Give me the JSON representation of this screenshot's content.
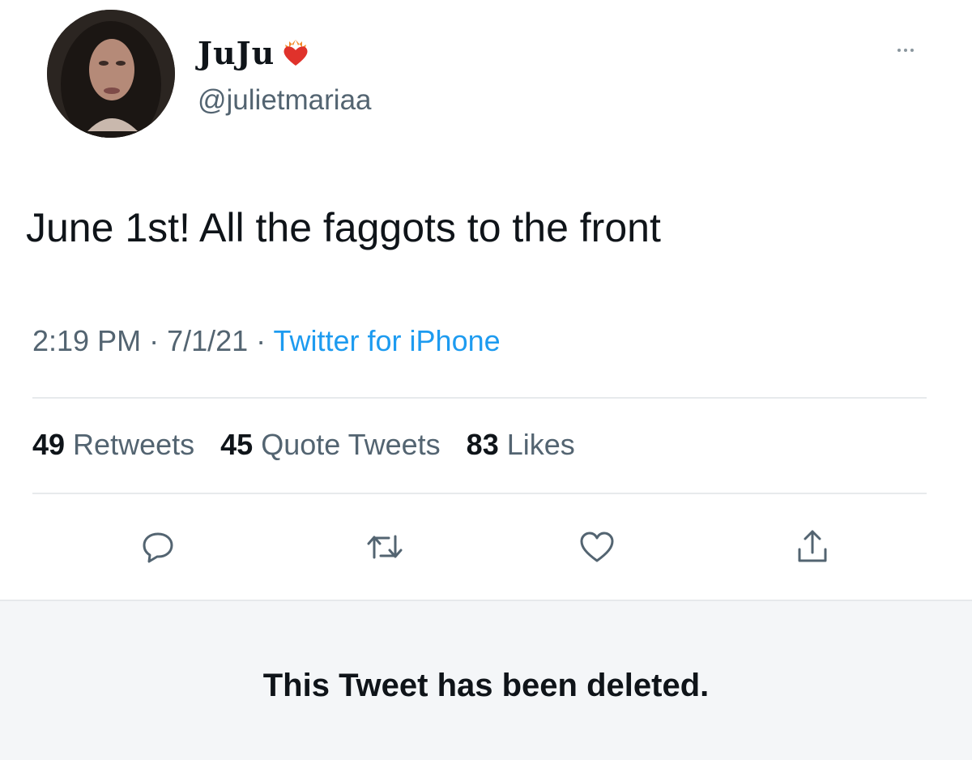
{
  "tweet": {
    "display_name": "JuJu",
    "name_emoji": "heart-on-fire-icon",
    "handle": "@julietmariaa",
    "text": "June 1st! All the faggots to the front",
    "meta": {
      "time": "2:19 PM",
      "separator": " · ",
      "date": "7/1/21",
      "source": "Twitter for iPhone"
    },
    "stats": [
      {
        "count": "49",
        "label": " Retweets"
      },
      {
        "count": "45",
        "label": " Quote Tweets"
      },
      {
        "count": "83",
        "label": " Likes"
      }
    ],
    "actions": [
      "reply-icon",
      "retweet-icon",
      "like-icon",
      "share-icon"
    ]
  },
  "banner": {
    "message": "This Tweet has been deleted."
  },
  "colors": {
    "text_primary": "#0f1419",
    "text_secondary": "#536471",
    "link": "#1d9bf0",
    "banner_bg": "#f4f6f8",
    "divider": "#e7eaec"
  }
}
